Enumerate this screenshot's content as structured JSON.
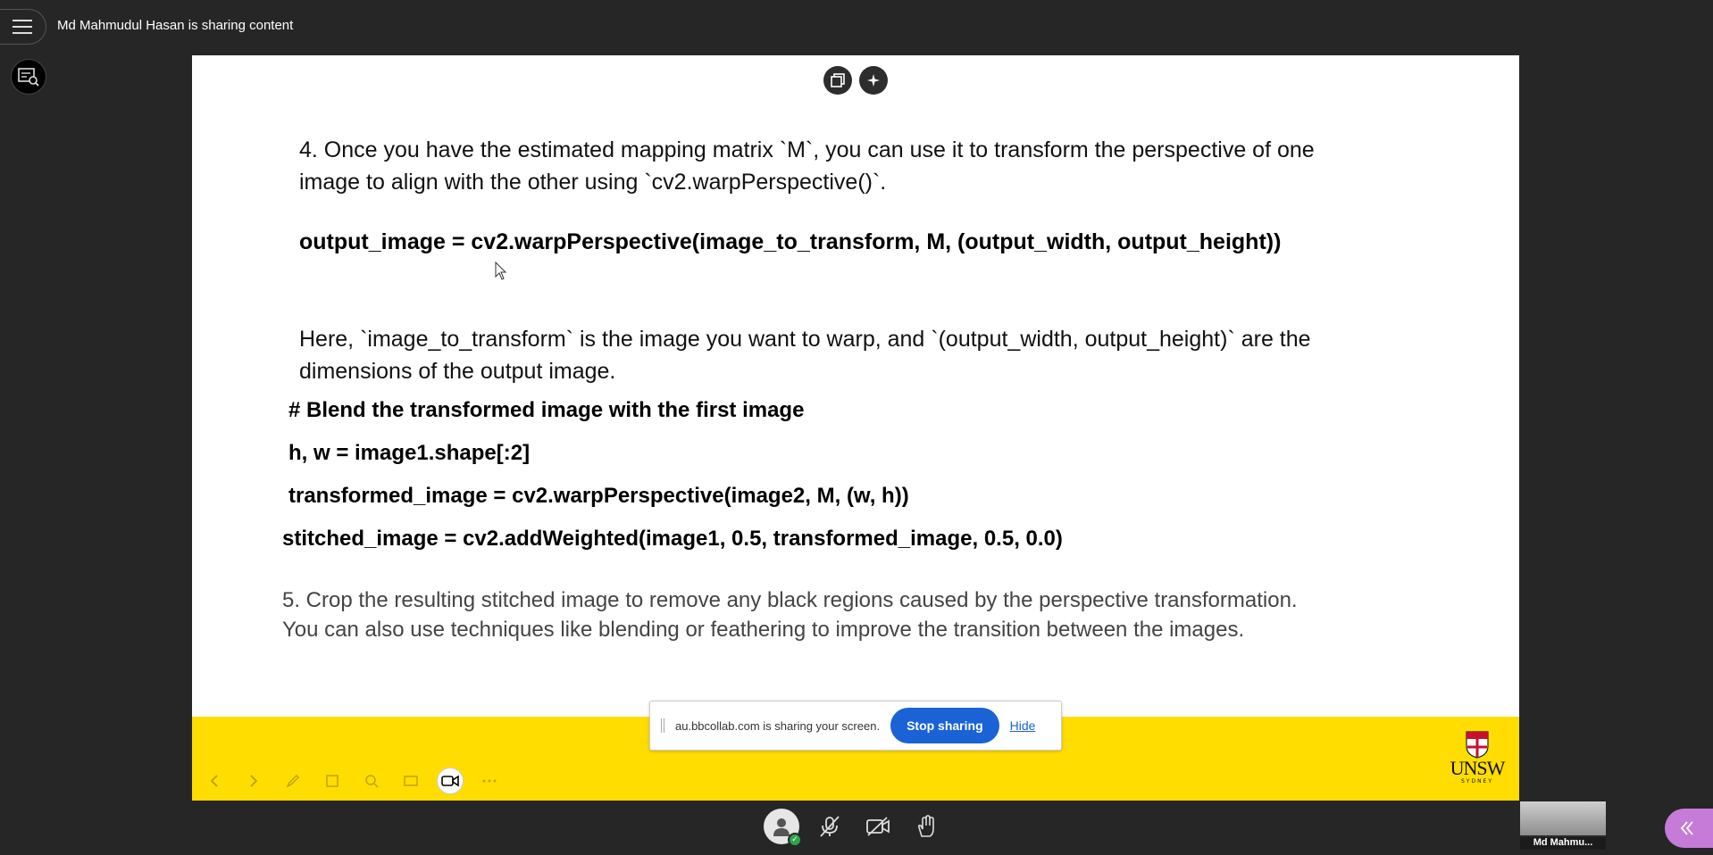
{
  "header": {
    "sharing_title": "Md Mahmudul Hasan is sharing content"
  },
  "slide": {
    "step4": "4. Once you have the estimated mapping matrix `M`, you can use it to transform the perspective of one image to align with the other using `cv2.warpPerspective()`.",
    "code_output": "output_image = cv2.warpPerspective(image_to_transform, M, (output_width, output_height))",
    "here_text": "Here, `image_to_transform` is the image you want to warp, and `(output_width, output_height)` are the dimensions of the output image.",
    "code_comment": "# Blend the transformed image with the first image",
    "code_shape": "h, w = image1.shape[:2]",
    "code_transformed": "transformed_image = cv2.warpPerspective(image2, M, (w, h))",
    "code_stitched": "stitched_image = cv2.addWeighted(image1, 0.5, transformed_image, 0.5, 0.0)",
    "step5": "5. Crop the resulting stitched image to remove any black regions caused by the perspective transformation. You can also use techniques like blending or feathering to improve the transition between the images.",
    "logo_text": "UNSW",
    "logo_sub": "SYDNEY",
    "accent_color": "#ffdd00"
  },
  "share_notice": {
    "message": "au.bbcollab.com is sharing your screen.",
    "stop_label": "Stop sharing",
    "hide_label": "Hide"
  },
  "participant": {
    "name": "Md Mahmu..."
  },
  "icons": [
    "menu-icon",
    "captions-icon",
    "copy-icon",
    "sparkle-icon",
    "avatar-icon",
    "mic-off-icon",
    "camera-off-icon",
    "hand-raise-icon",
    "collaborate-panel-icon"
  ]
}
